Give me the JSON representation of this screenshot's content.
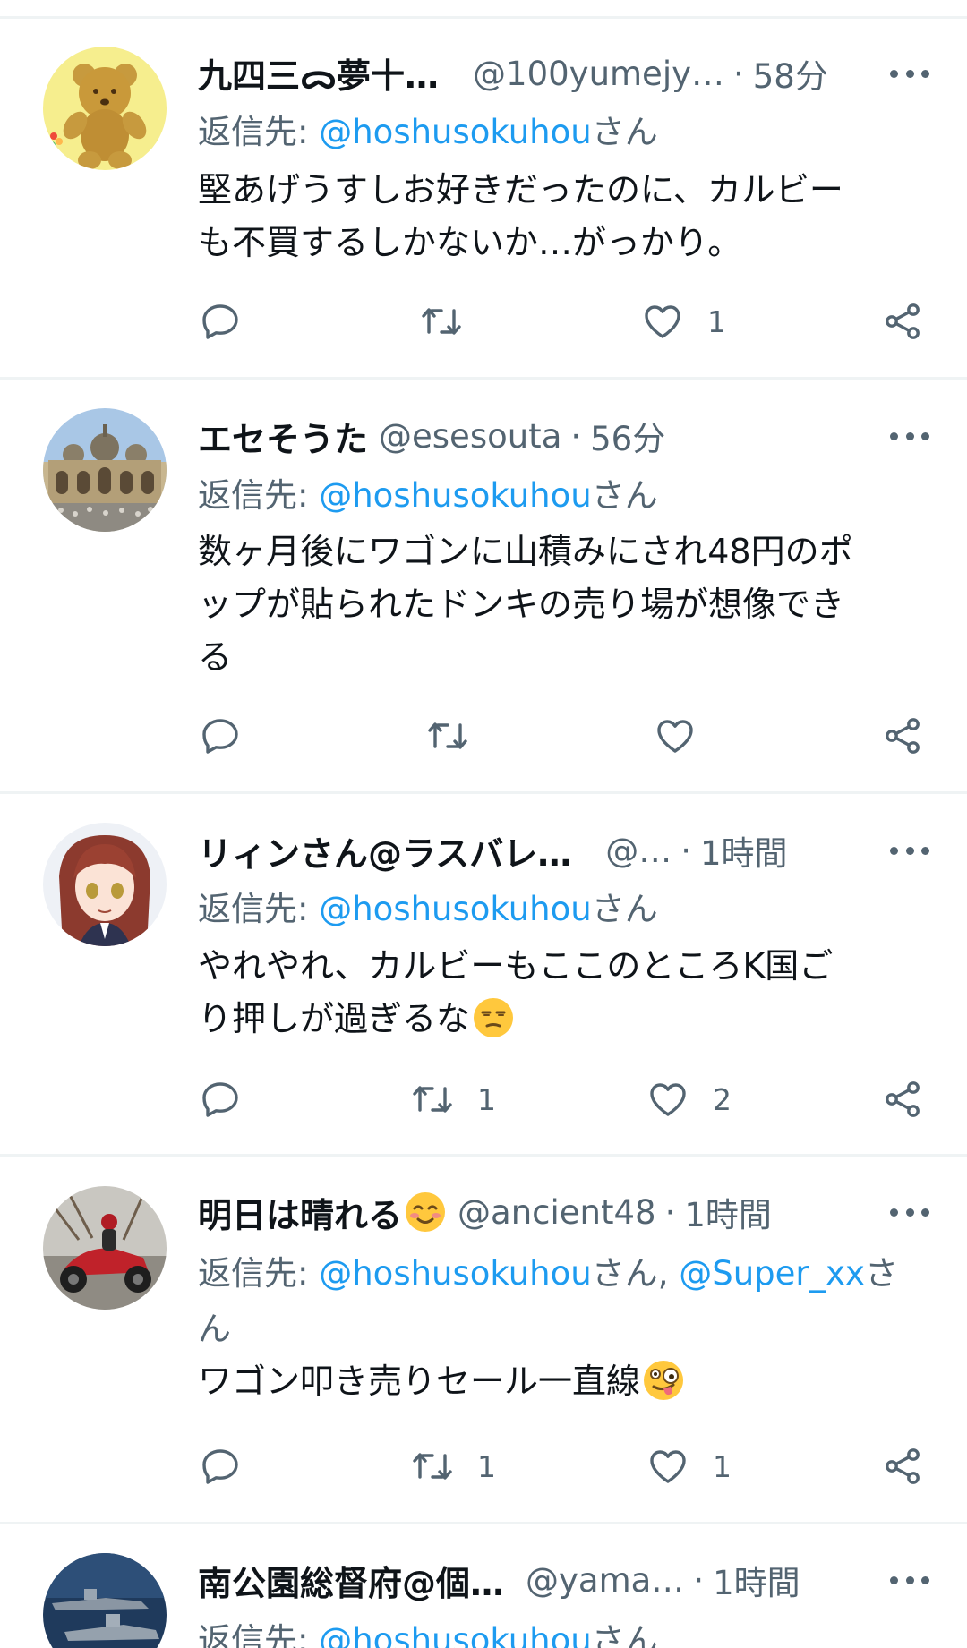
{
  "tweets": [
    {
      "display_name": "九四三ᯅ夢十…",
      "handle": "@100yumejy…",
      "time": "58分",
      "reply_prefix": "返信先: ",
      "reply_to": "@hoshusokuhou",
      "reply_suffix": "さん",
      "text_line1": "堅あげうすしお好きだったのに、カルビー",
      "text_line2": "も不買するしかないか…がっかり。",
      "retweets": "",
      "likes": "1"
    },
    {
      "display_name": "エセそうた",
      "handle": "@esesouta",
      "time": "56分",
      "reply_prefix": "返信先: ",
      "reply_to": "@hoshusokuhou",
      "reply_suffix": "さん",
      "text_line1": "数ヶ月後にワゴンに山積みにされ48円のポ",
      "text_line2": "ップが貼られたドンキの売り場が想像でき",
      "text_line3": "る",
      "retweets": "",
      "likes": ""
    },
    {
      "display_name": "リィンさん@ラスバレ…",
      "handle": "@…",
      "time": "1時間",
      "reply_prefix": "返信先: ",
      "reply_to": "@hoshusokuhou",
      "reply_suffix": "さん",
      "text_line1": "やれやれ、カルビーもここのところK国ご",
      "text_line2": "り押しが過ぎるな",
      "emoji": "unamused-face",
      "retweets": "1",
      "likes": "2"
    },
    {
      "display_name": "明日は晴れる",
      "name_emoji": "smiling-face-with-blush",
      "handle": "@ancient48",
      "time": "1時間",
      "reply_prefix": "返信先: ",
      "reply_to": "@hoshusokuhou",
      "reply_mid": "さん, ",
      "reply_to2": "@Super_xx",
      "reply_suffix_a": "さ",
      "reply_suffix_b": "ん",
      "text_line1": "ワゴン叩き売りセール一直線",
      "emoji": "zany-face",
      "retweets": "1",
      "likes": "1"
    },
    {
      "display_name": "南公園総督府@個…",
      "handle": "@yama…",
      "time": "1時間",
      "reply_prefix": "返信先: ",
      "reply_to": "@hoshusokuhou",
      "reply_suffix": "さん"
    }
  ],
  "colors": {
    "accent": "#1d9bf0",
    "secondary": "#536471",
    "divider": "#eff3f4"
  },
  "icons": [
    "reply-icon",
    "retweet-icon",
    "like-icon",
    "share-icon",
    "more-icon"
  ]
}
